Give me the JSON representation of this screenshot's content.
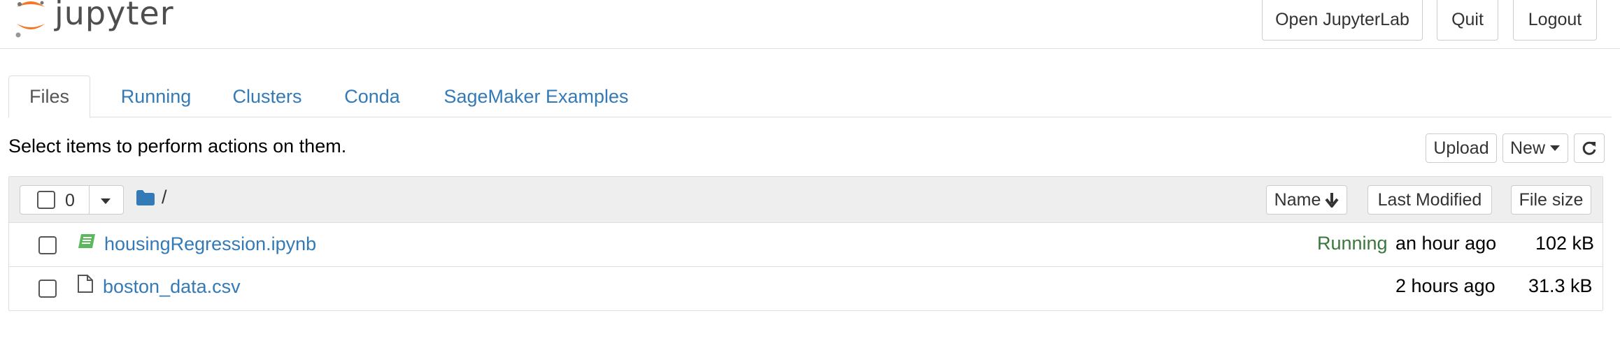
{
  "header": {
    "logo_text": "jupyter",
    "buttons": {
      "open_lab": "Open JupyterLab",
      "quit": "Quit",
      "logout": "Logout"
    }
  },
  "tabs": [
    {
      "label": "Files",
      "active": true
    },
    {
      "label": "Running",
      "active": false
    },
    {
      "label": "Clusters",
      "active": false
    },
    {
      "label": "Conda",
      "active": false
    },
    {
      "label": "SageMaker Examples",
      "active": false
    }
  ],
  "instructions": "Select items to perform actions on them.",
  "toolbar": {
    "upload": "Upload",
    "new": "New",
    "refresh_icon": "refresh-icon"
  },
  "list_header": {
    "selected_count": "0",
    "path": "/",
    "sort_name": "Name",
    "last_modified": "Last Modified",
    "file_size": "File size"
  },
  "files": [
    {
      "name": "housingRegression.ipynb",
      "icon": "notebook-icon",
      "status": "Running",
      "modified": "an hour ago",
      "size": "102 kB"
    },
    {
      "name": "boston_data.csv",
      "icon": "file-icon",
      "status": "",
      "modified": "2 hours ago",
      "size": "31.3 kB"
    }
  ],
  "colors": {
    "link": "#337ab7",
    "running": "#3c763d",
    "logo_orange": "#f37726",
    "notebook_green": "#5cb85c"
  }
}
